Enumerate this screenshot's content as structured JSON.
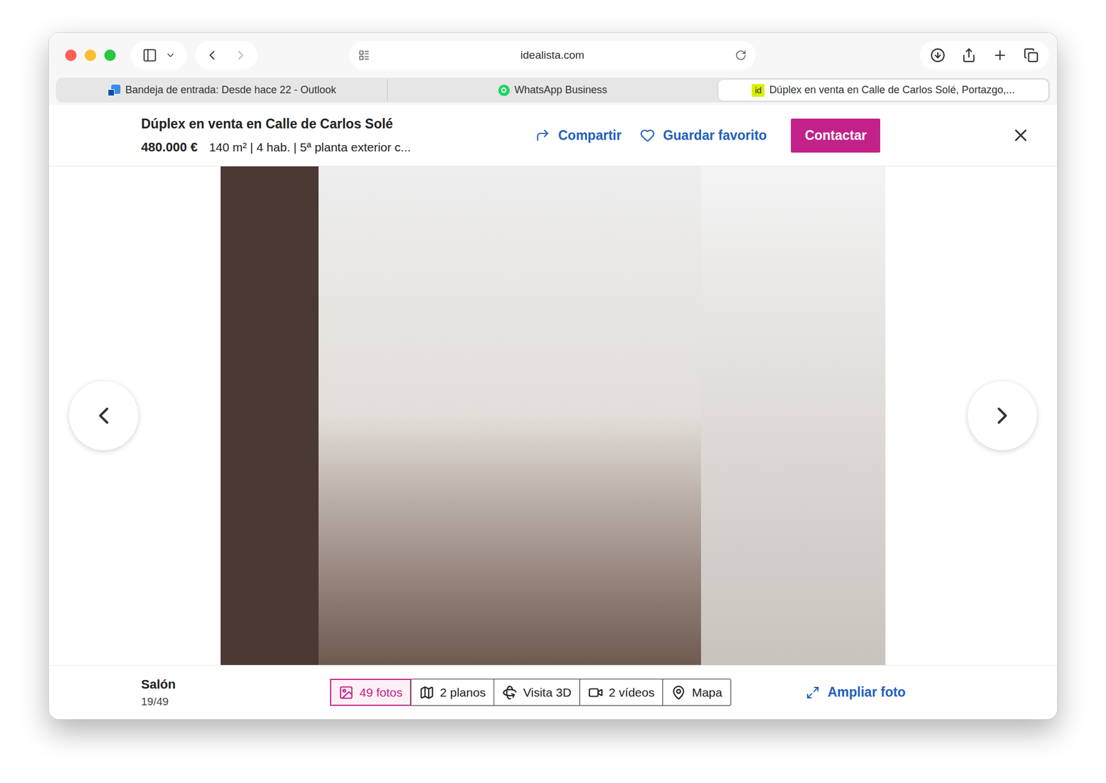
{
  "window": {
    "url": "idealista.com"
  },
  "tabs": [
    {
      "label": "Bandeja de entrada: Desde hace 22 - Outlook",
      "selected": false,
      "kind": "outlook",
      "favicon": ""
    },
    {
      "label": "WhatsApp Business",
      "selected": false,
      "kind": "whatsapp",
      "favicon": ""
    },
    {
      "label": "Dúplex en venta en Calle de Carlos Solé, Portazgo,...",
      "selected": true,
      "kind": "idealista",
      "favicon": "id"
    }
  ],
  "listing": {
    "title": "Dúplex en venta en Calle de Carlos Solé",
    "price": "480.000 €",
    "details": "140 m² | 4 hab. | 5ª planta exterior c..."
  },
  "actions": [
    {
      "label": "Compartir",
      "kind": "share"
    },
    {
      "label": "Guardar favorito",
      "kind": "favorite"
    },
    {
      "label": "Contactar",
      "kind": "contact"
    }
  ],
  "photo": {
    "caption": "Salón",
    "counter": "19/49"
  },
  "media_tabs": [
    {
      "label": "49 fotos",
      "selected": true,
      "kind": "photos"
    },
    {
      "label": "2 planos",
      "selected": false,
      "kind": "plans"
    },
    {
      "label": "Visita 3D",
      "selected": false,
      "kind": "tour"
    },
    {
      "label": "2 vídeos",
      "selected": false,
      "kind": "videos"
    },
    {
      "label": "Mapa",
      "selected": false,
      "kind": "map"
    }
  ],
  "expand": {
    "label": "Ampliar foto"
  }
}
